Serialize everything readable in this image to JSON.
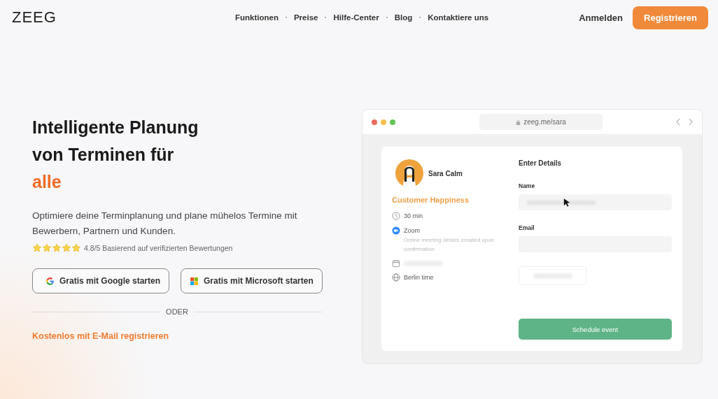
{
  "header": {
    "logo": "ZEEG",
    "nav": [
      "Funktionen",
      "Preise",
      "Hilfe-Center",
      "Blog",
      "Kontaktiere uns"
    ],
    "login": "Anmelden",
    "register": "Registrieren"
  },
  "hero": {
    "title_lines": [
      "Intelligente Planung",
      "von Terminen für"
    ],
    "title_accent": "alle",
    "subtitle": "Optimiere deine Terminplanung und plane mühelos Termine mit Bewerbern, Partnern und Kunden.",
    "rating": {
      "stars": 5,
      "text": "4.8/5 Basierend auf verifizierten Bewertungen"
    },
    "buttons": [
      {
        "kind": "google",
        "label": "Gratis mit Google starten"
      },
      {
        "kind": "microsoft",
        "label": "Gratis mit Microsoft starten"
      }
    ],
    "divider": "ODER",
    "email_link": "Kostenlos mit E-Mail registrieren"
  },
  "preview": {
    "url": "zeeg.me/sara",
    "host": "Sara Calm",
    "event": "Customer Happiness",
    "details": [
      {
        "kind": "clock",
        "text": "30 min"
      },
      {
        "kind": "video",
        "text": "Zoom",
        "note": "Online meeting details emailed upon confirmation"
      },
      {
        "kind": "calendar"
      },
      {
        "kind": "globe",
        "text": "Berlin time"
      }
    ],
    "form_title": "Enter Details",
    "fields": [
      {
        "label": "Name",
        "filled": true
      },
      {
        "label": "Email",
        "filled": false
      }
    ],
    "submit": "Schedule event"
  }
}
